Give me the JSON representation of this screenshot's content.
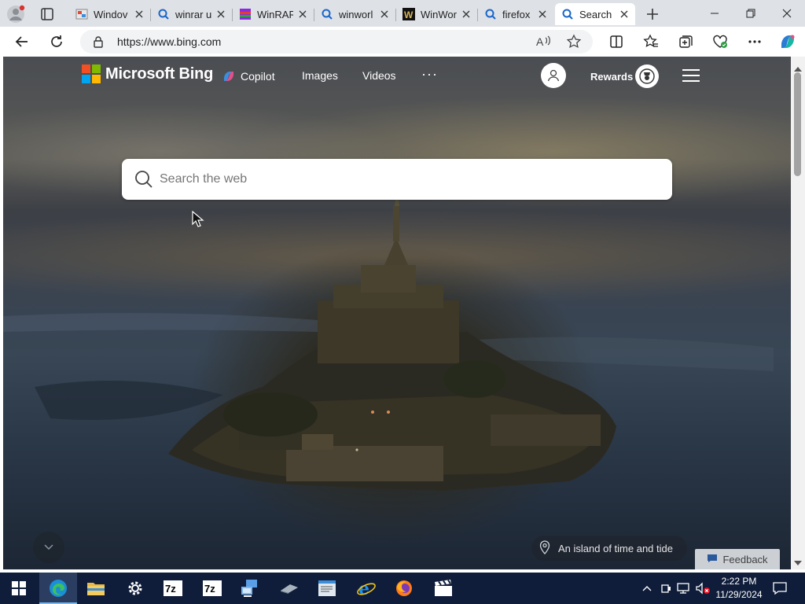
{
  "browser": {
    "tabs": [
      {
        "title": "Windov",
        "favicon": "image-favicon",
        "active": false
      },
      {
        "title": "winrar u",
        "favicon": "search-favicon",
        "active": false
      },
      {
        "title": "WinRAR",
        "favicon": "winrar-favicon",
        "active": false
      },
      {
        "title": "winworl",
        "favicon": "search-favicon",
        "active": false
      },
      {
        "title": "WinWor",
        "favicon": "winworld-favicon",
        "active": false
      },
      {
        "title": "firefox d",
        "favicon": "search-favicon",
        "active": false
      },
      {
        "title": "Search",
        "favicon": "search-favicon",
        "active": true
      }
    ],
    "address": {
      "url": "https://www.bing.com"
    }
  },
  "bing": {
    "brand": "Microsoft Bing",
    "nav": {
      "copilot": "Copilot",
      "images": "Images",
      "videos": "Videos",
      "more": "···"
    },
    "rewards": "Rewards",
    "search": {
      "placeholder": "Search the web"
    },
    "image_caption": "An island of time and tide",
    "feedback": "Feedback"
  },
  "taskbar": {
    "apps": [
      "start-icon",
      "edge-icon",
      "file-explorer-icon",
      "settings-icon",
      "7zip-icon",
      "7zip-icon",
      "network-app-icon",
      "usb-drive-icon",
      "text-editor-icon",
      "internet-explorer-icon",
      "firefox-icon",
      "clapper-icon"
    ],
    "active_app": "edge-icon",
    "time": "2:22 PM",
    "date": "11/29/2024"
  },
  "colors": {
    "taskbar": "#0f1d3a",
    "tabstrip": "#dee1e6",
    "ms_red": "#f25022",
    "ms_green": "#7fba00",
    "ms_blue": "#00a4ef",
    "ms_yellow": "#ffb900"
  }
}
